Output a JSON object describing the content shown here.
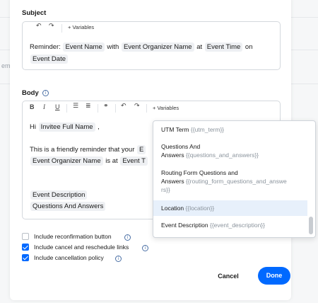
{
  "background": {
    "fragment_text": "em"
  },
  "subject": {
    "label": "Subject",
    "toolbar": {
      "undo_icon": "undo-icon",
      "redo_icon": "redo-icon",
      "variables_label": "+ Variables"
    },
    "line1": {
      "prefix": "Reminder: ",
      "chip1": "Event Name",
      "mid1": " with ",
      "chip2": "Event Organizer Name",
      "mid2": " at ",
      "chip3": "Event Time",
      "suffix": " on"
    },
    "line2": {
      "chip1": "Event Date"
    }
  },
  "body": {
    "label": "Body",
    "toolbar": {
      "bold": "B",
      "italic": "I",
      "underline": "U",
      "variables_label": "+ Variables"
    },
    "line1": {
      "prefix": "Hi ",
      "chip1": "Invitee Full Name",
      "suffix": " ,"
    },
    "line2": {
      "text": "This is a friendly reminder that your ",
      "chip_partial": "E"
    },
    "line3": {
      "chip1": "Event Organizer Name",
      "mid": " is at ",
      "chip2_partial": "Event T"
    },
    "line4": {
      "chip1": "Event Description"
    },
    "line5": {
      "chip1": "Questions And Answers"
    }
  },
  "dropdown": {
    "items": [
      {
        "name": "UTM Term",
        "token": "{{utm_term}}"
      },
      {
        "name": "Questions And",
        "name2": "Answers",
        "token": "{{questions_and_answers}}"
      },
      {
        "name": "Routing Form Questions and",
        "name2": "Answers",
        "token": "{{routing_form_questions_and_answe",
        "token2": "rs}}"
      },
      {
        "name": "Location",
        "token": "{{location}}"
      },
      {
        "name": "Event Description",
        "token": "{{event_description}}"
      }
    ]
  },
  "options": [
    {
      "label": "Include reconfirmation button",
      "checked": false
    },
    {
      "label": "Include cancel and reschedule links",
      "checked": true
    },
    {
      "label": "Include cancellation policy",
      "checked": true
    }
  ],
  "actions": {
    "cancel": "Cancel",
    "done": "Done"
  },
  "colors": {
    "primary": "#0069ff",
    "highlight": "#e7f0fb",
    "chip": "#eef0f3"
  }
}
